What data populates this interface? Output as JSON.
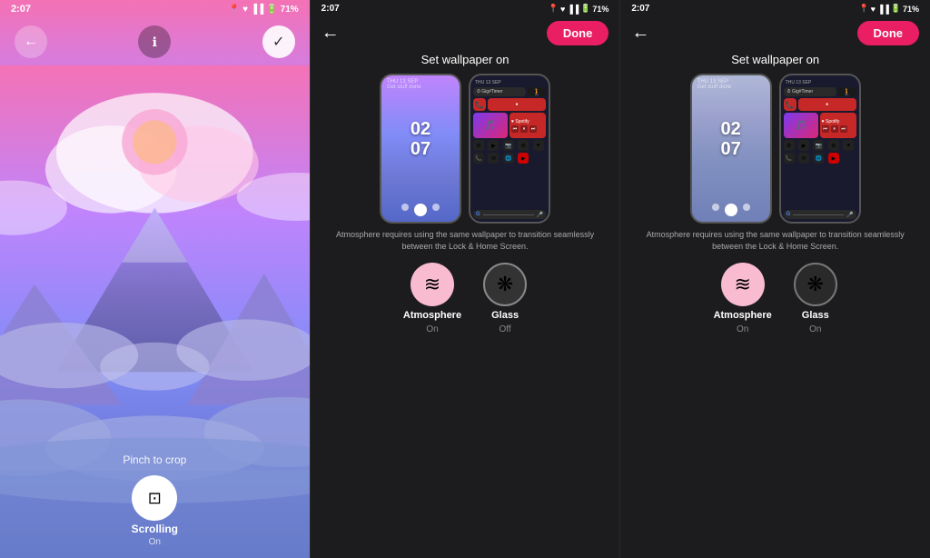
{
  "panel1": {
    "status": {
      "time": "2:07",
      "icons": "📍♥📶📶🔋71%"
    },
    "pinch_label": "Pinch to crop",
    "scroll_btn_label": "Scrolling",
    "scroll_btn_sublabel": "On"
  },
  "panel2": {
    "status": {
      "time": "2:07"
    },
    "done_label": "Done",
    "set_wallpaper_label": "Set wallpaper on",
    "notice": "Atmosphere requires using the same wallpaper to transition seamlessly between the Lock & Home Screen.",
    "options": [
      {
        "label": "Atmosphere",
        "sublabel": "On",
        "selected": false
      },
      {
        "label": "Glass",
        "sublabel": "Off",
        "selected": true
      }
    ]
  },
  "panel3": {
    "status": {
      "time": "2:07"
    },
    "done_label": "Done",
    "set_wallpaper_label": "Set wallpaper on",
    "notice": "Atmosphere requires using the same wallpaper to transition seamlessly between the Lock & Home Screen.",
    "options": [
      {
        "label": "Atmosphere",
        "sublabel": "On",
        "selected": false
      },
      {
        "label": "Glass",
        "sublabel": "On",
        "selected": true
      }
    ]
  }
}
